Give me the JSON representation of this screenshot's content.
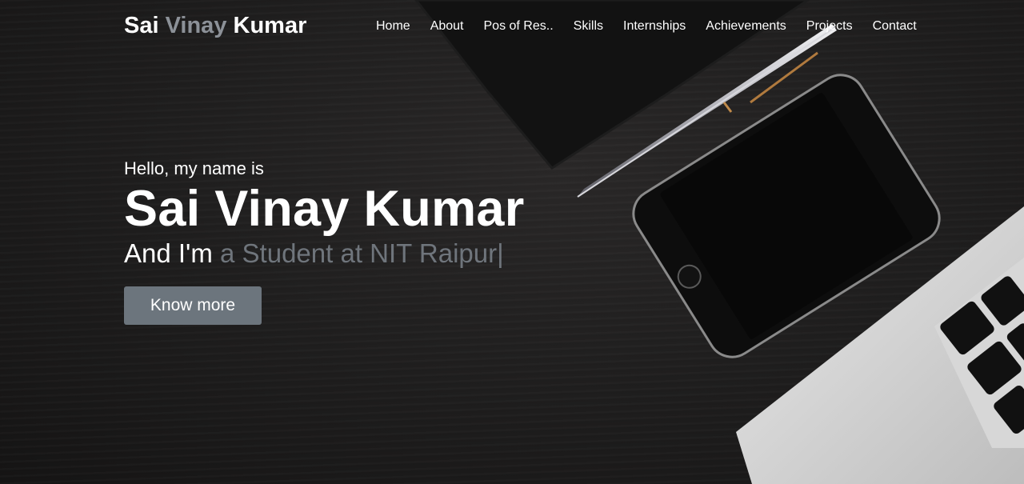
{
  "navbar": {
    "logo": {
      "part1": "Sai ",
      "accent": "Vinay",
      "part2": " Kumar"
    },
    "links": [
      "Home",
      "About",
      "Pos of Res..",
      "Skills",
      "Internships",
      "Achievements",
      "Projects",
      "Contact"
    ]
  },
  "hero": {
    "greeting": "Hello, my name is",
    "name": "Sai Vinay Kumar",
    "tagline_prefix": "And I'm ",
    "tagline_typed": "a Student at NIT Raipur",
    "cursor": "|",
    "button_label": "Know more"
  },
  "colors": {
    "accent": "#8c9198",
    "button_bg": "#6c757d",
    "text": "#ffffff"
  },
  "icons": [
    "notebook-image",
    "pen-image",
    "smartphone-image",
    "laptop-image"
  ]
}
